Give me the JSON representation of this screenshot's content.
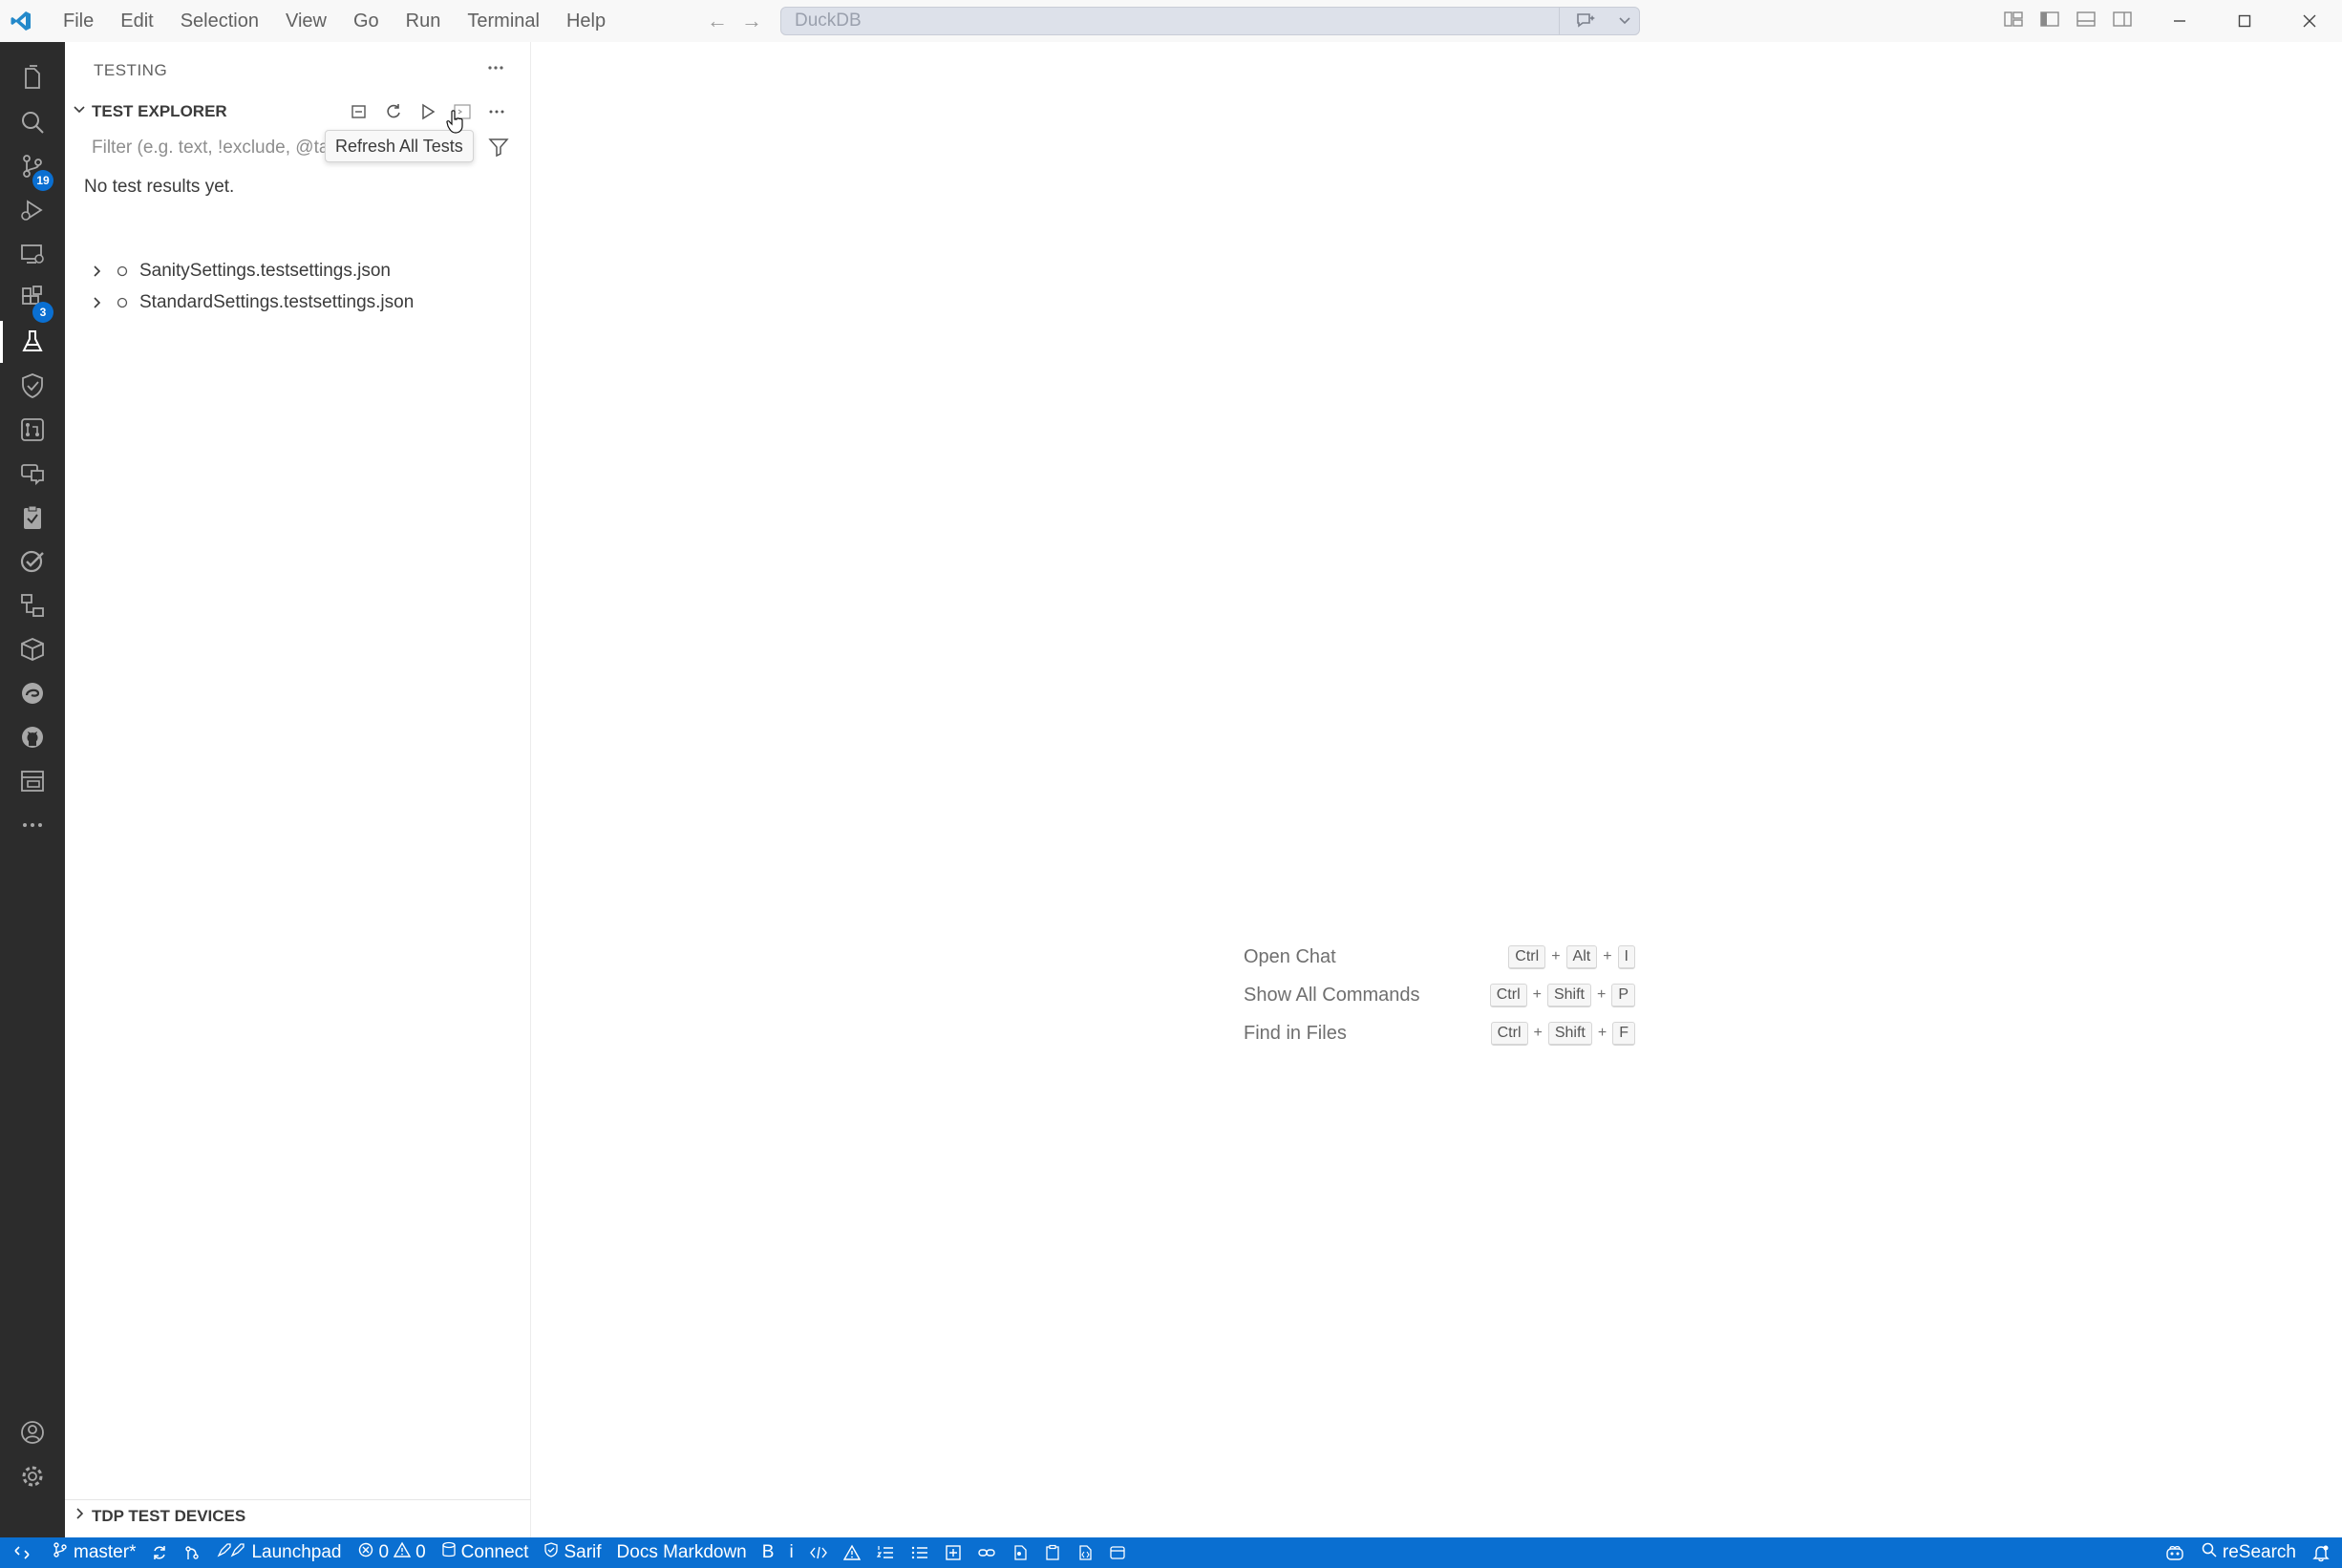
{
  "titlebar": {
    "menu": [
      "File",
      "Edit",
      "Selection",
      "View",
      "Go",
      "Run",
      "Terminal",
      "Help"
    ],
    "command_center_title": "DuckDB"
  },
  "activity_bar": {
    "items": [
      {
        "icon": "explorer-icon"
      },
      {
        "icon": "search-icon"
      },
      {
        "icon": "source-control-icon",
        "badge": "19"
      },
      {
        "icon": "run-debug-icon"
      },
      {
        "icon": "remote-explorer-icon"
      },
      {
        "icon": "extensions-icon",
        "badge": "3"
      },
      {
        "icon": "testing-icon",
        "active": true
      },
      {
        "icon": "shield-icon"
      },
      {
        "icon": "pull-request-icon"
      },
      {
        "icon": "remote-chat-icon"
      },
      {
        "icon": "clipboard-check-icon"
      },
      {
        "icon": "task-check-icon"
      },
      {
        "icon": "hierarchy-icon"
      },
      {
        "icon": "package-icon"
      },
      {
        "icon": "edge-icon"
      },
      {
        "icon": "github-icon"
      },
      {
        "icon": "database-icon"
      },
      {
        "icon": "more-icon"
      }
    ],
    "bottom": [
      {
        "icon": "account-icon"
      },
      {
        "icon": "settings-gear-icon"
      }
    ]
  },
  "sidebar": {
    "header": "TESTING",
    "section_title": "TEST EXPLORER",
    "filter_placeholder": "Filter (e.g. text, !exclude, @tag)",
    "tooltip": "Refresh All Tests",
    "no_results": "No test results yet.",
    "tests": [
      {
        "label": "SanitySettings.testsettings.json"
      },
      {
        "label": "StandardSettings.testsettings.json"
      }
    ],
    "bottom_section": "TDP TEST DEVICES"
  },
  "editor": {
    "shortcuts": [
      {
        "label": "Open Chat",
        "keys": [
          "Ctrl",
          "Alt",
          "I"
        ]
      },
      {
        "label": "Show All Commands",
        "keys": [
          "Ctrl",
          "Shift",
          "P"
        ]
      },
      {
        "label": "Find in Files",
        "keys": [
          "Ctrl",
          "Shift",
          "F"
        ]
      }
    ]
  },
  "statusbar": {
    "branch": "master*",
    "launchpad": "Launchpad",
    "errors": "0",
    "warnings": "0",
    "connect": "Connect",
    "sarif": "Sarif",
    "docs": "Docs Markdown",
    "bold": "B",
    "italic": "i",
    "research": "reSearch",
    "background_color": "#0a6fd1"
  }
}
